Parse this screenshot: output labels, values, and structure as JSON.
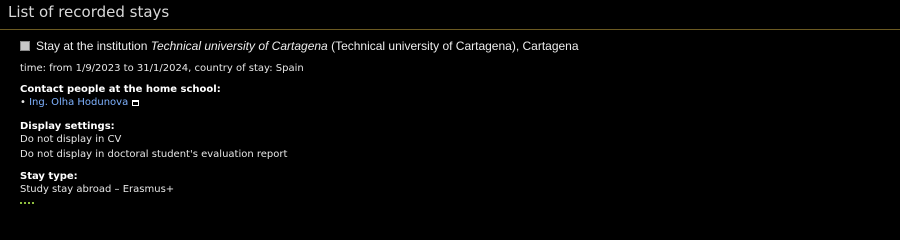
{
  "section": {
    "title": "List of recorded stays"
  },
  "stay": {
    "prefix": "Stay at the institution ",
    "institution": "Technical university of Cartagena",
    "suffix": " (Technical university of Cartagena), Cartagena",
    "time": "time: from 1/9/2023 to 31/1/2024, country of stay: Spain",
    "contact_label": "Contact people at the home school:",
    "contact_bullet": "•",
    "contact_name": "Ing. Olha Hodunova",
    "display_label": "Display settings:",
    "display_cv": "Do not display in CV",
    "display_report": "Do not display in doctoral student's evaluation report",
    "type_label": "Stay type:",
    "type_value": "Study stay abroad – Erasmus+"
  },
  "colors": {
    "title_rule": "#6b5a22",
    "link": "#7fb2ff"
  },
  "icons": {
    "contact_link": "external-window-icon"
  }
}
